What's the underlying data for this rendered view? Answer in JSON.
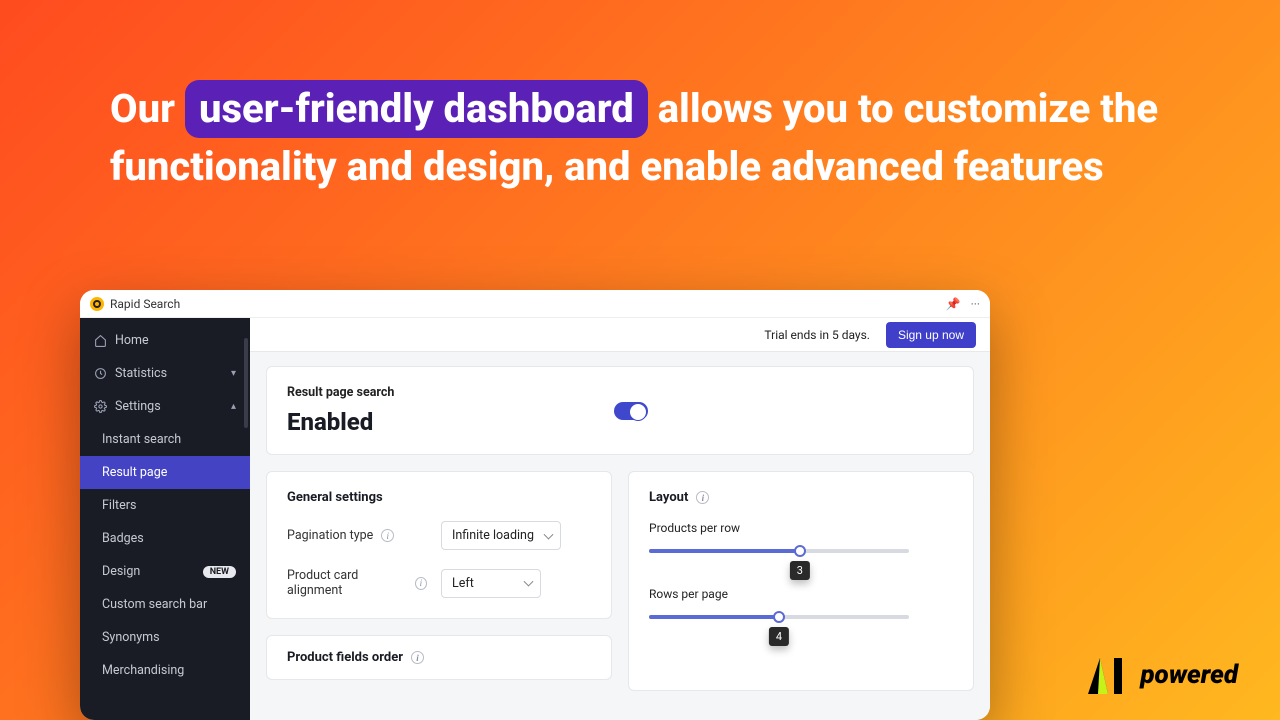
{
  "hero": {
    "pre": "Our ",
    "highlight": "user-friendly dashboard",
    "post": " allows you to customize the functionality and design, and enable advanced features"
  },
  "window": {
    "title": "Rapid Search",
    "pin_glyph": "📌",
    "more_glyph": "···"
  },
  "sidebar": {
    "home": "Home",
    "stats": "Statistics",
    "settings": "Settings",
    "items": [
      "Instant search",
      "Result page",
      "Filters",
      "Badges",
      "Design",
      "Custom search bar",
      "Synonyms",
      "Merchandising"
    ],
    "new_badge": "NEW"
  },
  "topbar": {
    "trial": "Trial ends in 5 days.",
    "signup": "Sign up now"
  },
  "header_card": {
    "subtitle": "Result page search",
    "title": "Enabled",
    "toggle_on": true
  },
  "general": {
    "title": "General settings",
    "pagination_label": "Pagination type",
    "pagination_value": "Infinite loading",
    "alignment_label": "Product card alignment",
    "alignment_value": "Left"
  },
  "layout": {
    "title": "Layout",
    "ppr_label": "Products per row",
    "ppr_value": "3",
    "ppr_pct": 58,
    "rpp_label": "Rows per page",
    "rpp_value": "4",
    "rpp_pct": 50
  },
  "fields_order": {
    "title": "Product fields order"
  },
  "footer_logo": {
    "text": "powered"
  }
}
